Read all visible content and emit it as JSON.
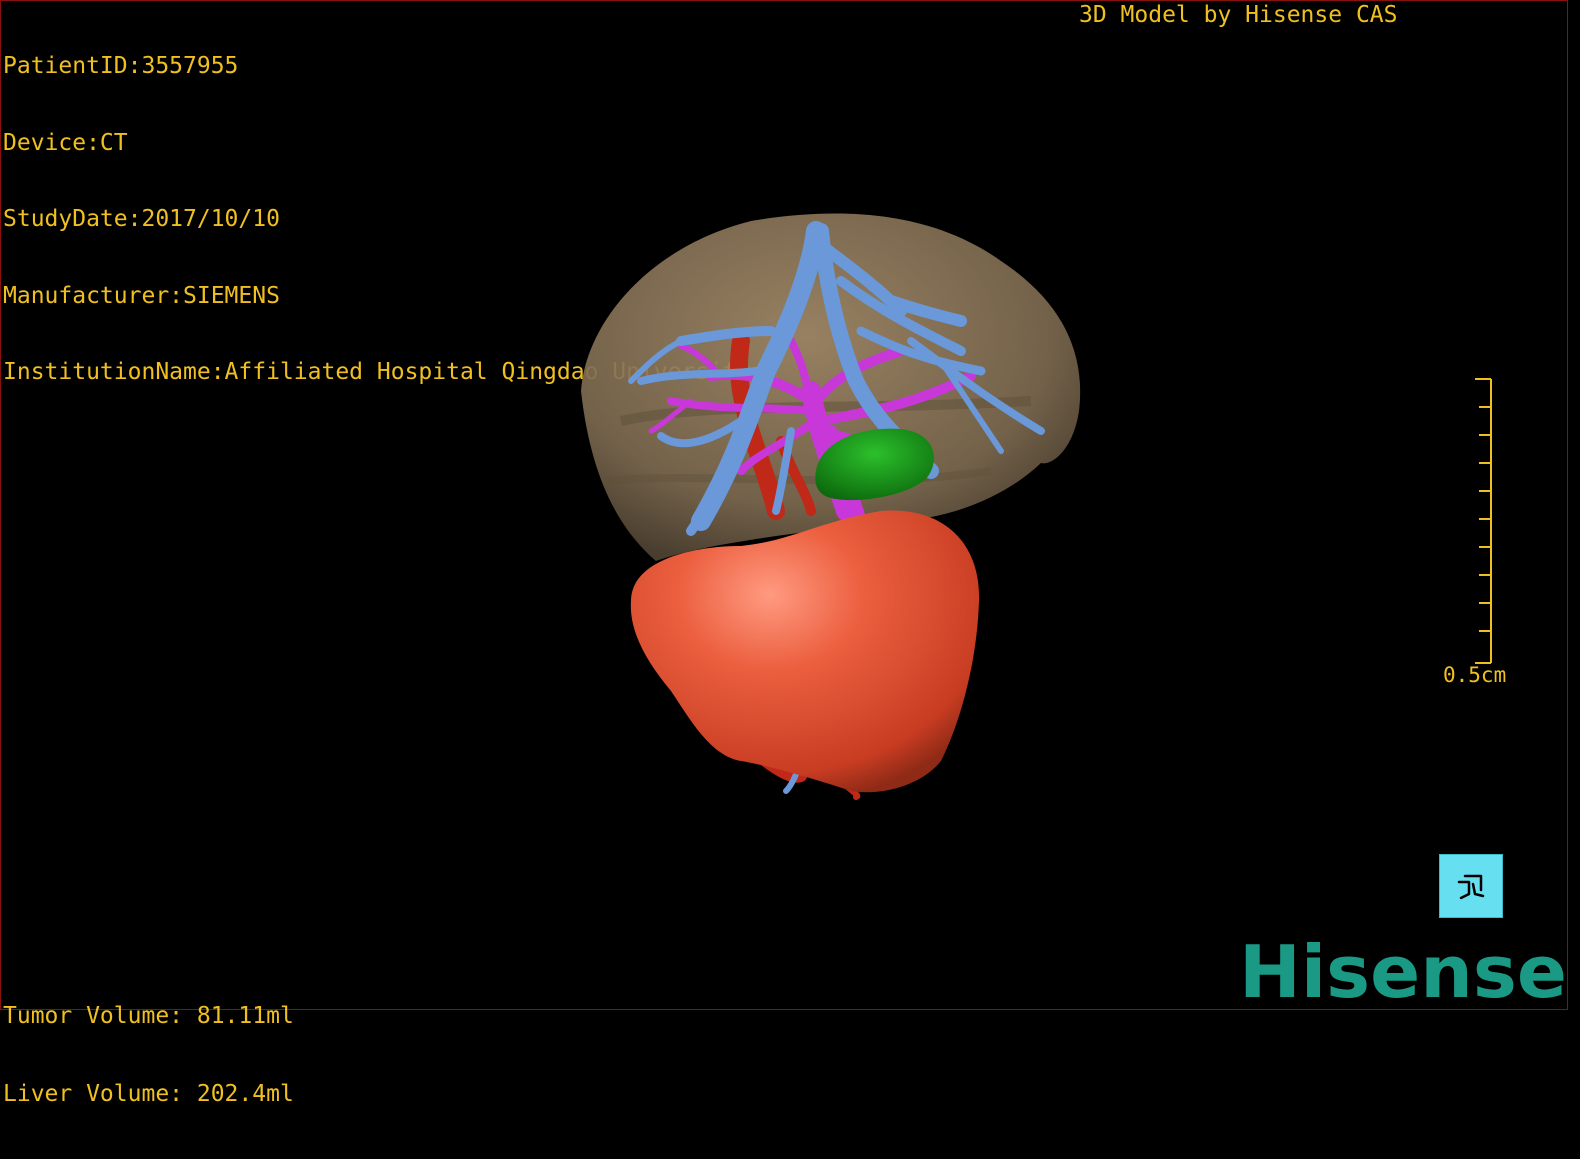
{
  "overlay": {
    "patient_id": "PatientID:3557955",
    "device": "Device:CT",
    "study_date": "StudyDate:2017/10/10",
    "manufacturer": "Manufacturer:SIEMENS",
    "institution": "InstitutionName:Affiliated Hospital Qingdao University-C",
    "credit": "3D Model by Hisense CAS",
    "tumor_volume": "Tumor Volume: 81.11ml",
    "liver_volume": "Liver Volume: 202.4ml"
  },
  "scale": {
    "label": "0.5cm",
    "tick_count": 10
  },
  "orientation_button": {
    "icon": "orientation-figure-icon"
  },
  "logo": {
    "text": "Hisense"
  },
  "colors": {
    "overlay_text": "#f0c020",
    "liver": "#8a7558",
    "portal_vein": "#6a98d8",
    "hepatic_vein": "#c838d8",
    "artery": "#c02818",
    "gallbladder": "#1a8a1a",
    "tumor": "#e05030",
    "logo": "#1a9a84",
    "orient_button": "#66e0f0"
  }
}
